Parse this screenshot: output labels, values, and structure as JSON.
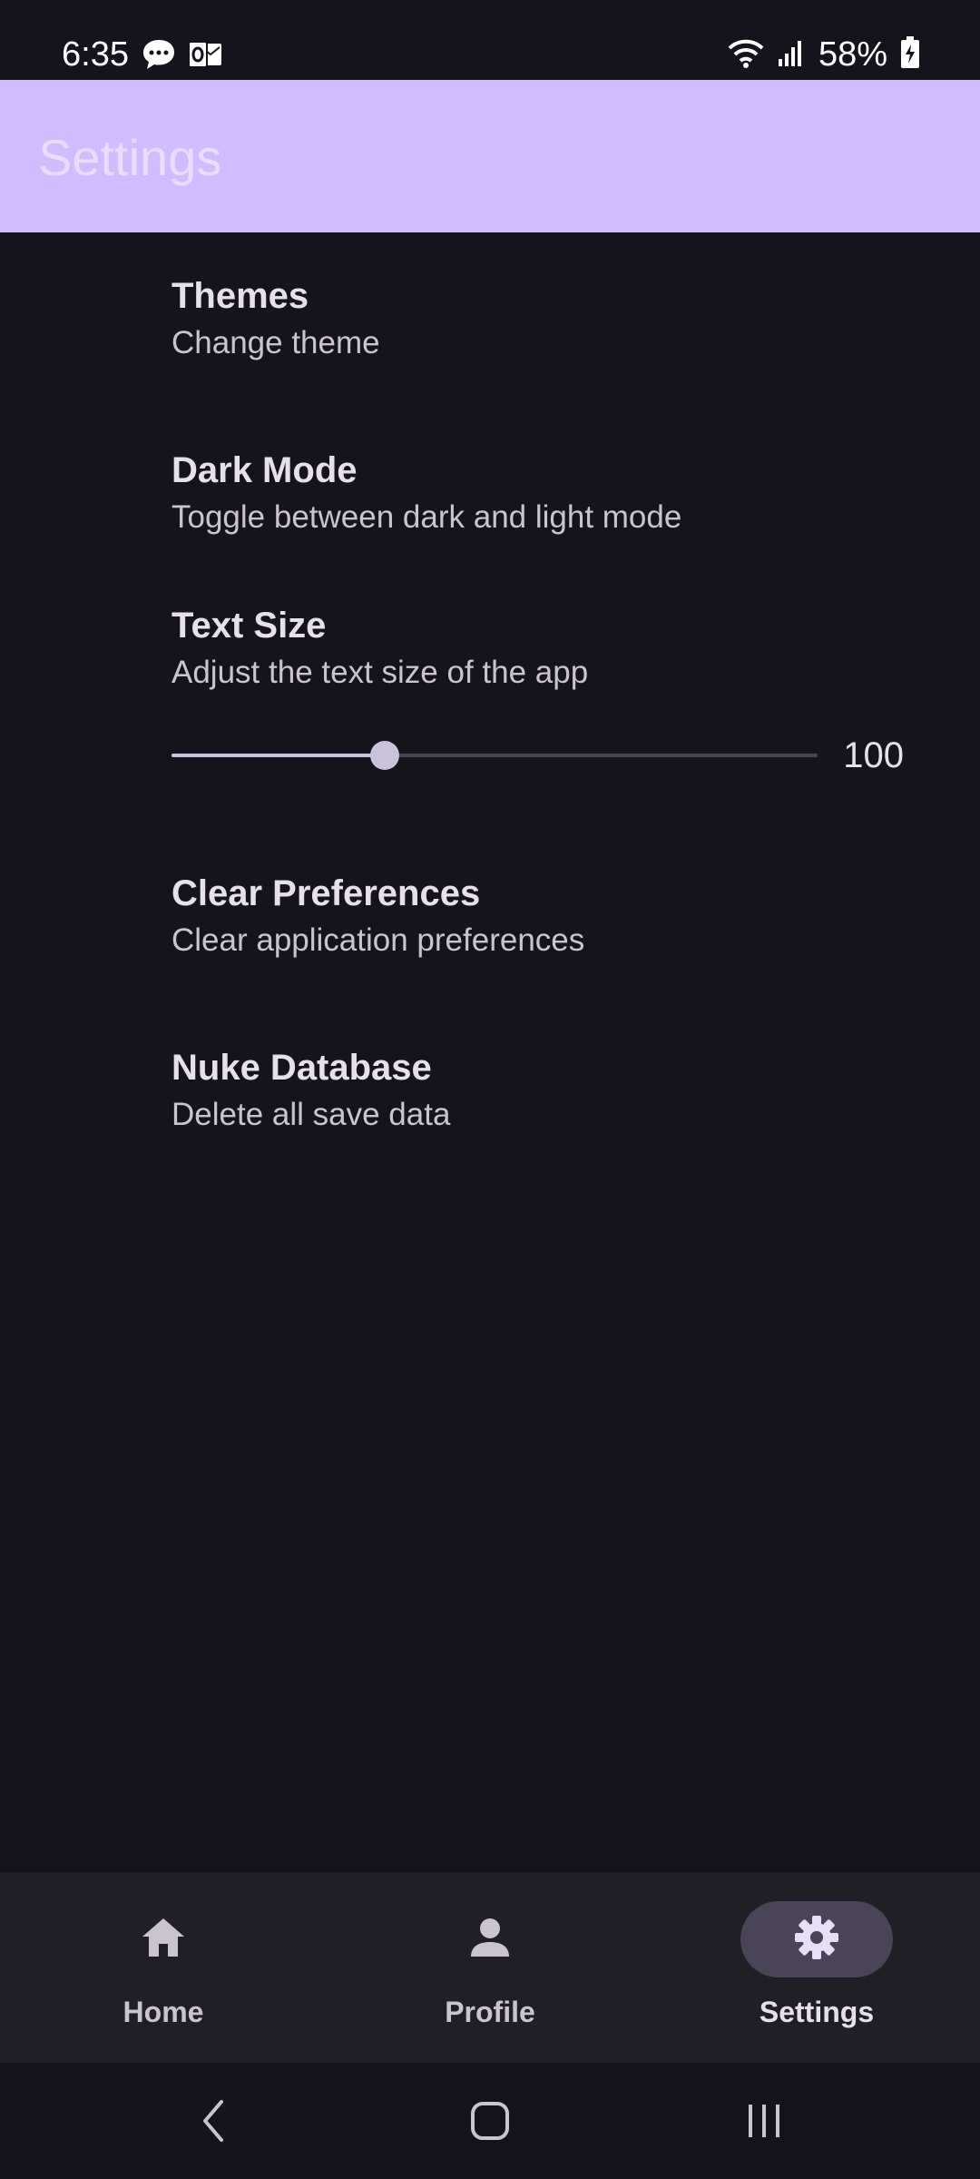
{
  "status_bar": {
    "time": "6:35",
    "battery": "58%",
    "icons": [
      "chat-bubble-icon",
      "outlook-icon",
      "wifi-icon",
      "signal-icon",
      "battery-charging-icon"
    ]
  },
  "app_bar": {
    "title": "Settings"
  },
  "settings": {
    "items": [
      {
        "title": "Themes",
        "subtitle": "Change theme"
      },
      {
        "title": "Dark Mode",
        "subtitle": "Toggle between dark and light mode"
      },
      {
        "title": "Text Size",
        "subtitle": "Adjust the text size of the app"
      },
      {
        "title": "Clear Preferences",
        "subtitle": "Clear application preferences"
      },
      {
        "title": "Nuke Database",
        "subtitle": "Delete all save data"
      }
    ],
    "text_size_slider": {
      "value": "100",
      "fraction": 0.33
    }
  },
  "bottom_nav": {
    "items": [
      {
        "label": "Home",
        "icon": "home-icon",
        "active": false
      },
      {
        "label": "Profile",
        "icon": "person-icon",
        "active": false
      },
      {
        "label": "Settings",
        "icon": "gear-icon",
        "active": true
      }
    ]
  },
  "system_nav": {
    "buttons": [
      "back-icon",
      "home-button-icon",
      "recents-icon"
    ]
  },
  "colors": {
    "background": "#15131b",
    "app_bar": "#d0bcff",
    "nav_bar": "#211f26",
    "active_indicator": "#4a4458"
  }
}
